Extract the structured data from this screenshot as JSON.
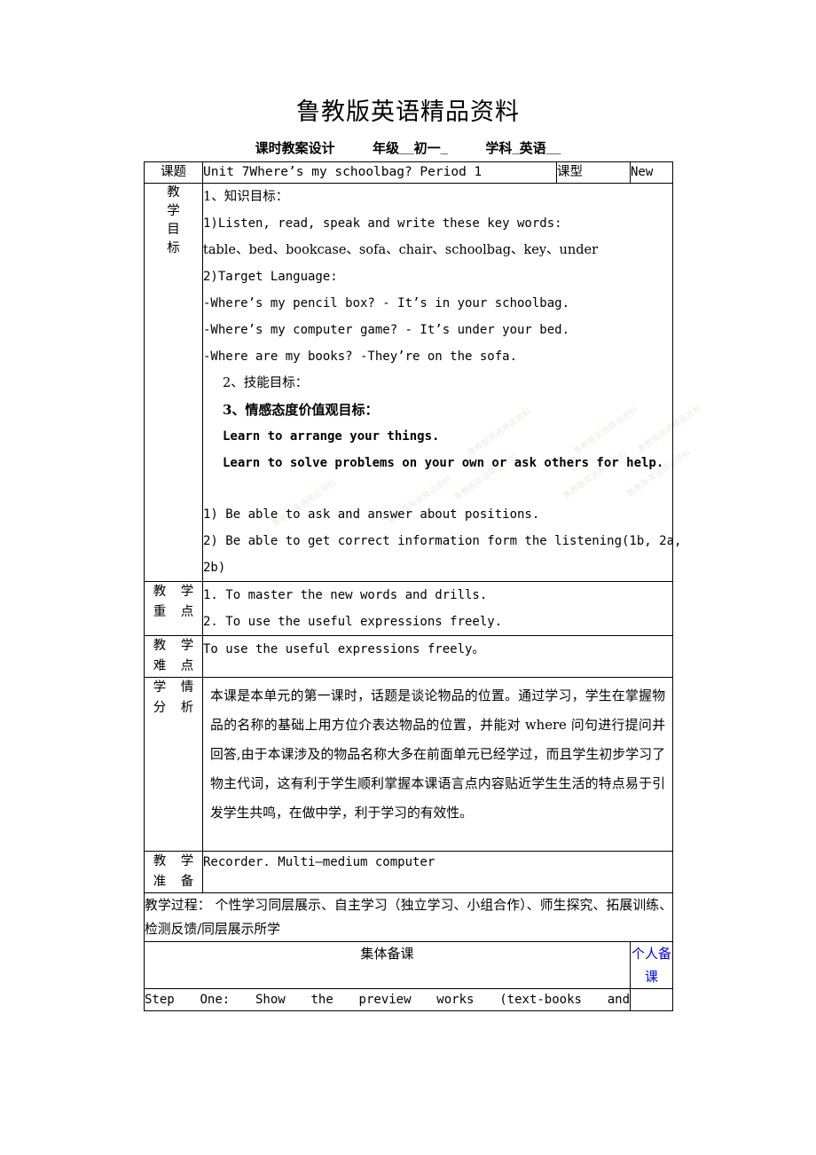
{
  "header": {
    "title": "鲁教版英语精品资料",
    "subtitle_main": "课时教案设计",
    "subtitle_grade": "年级__初一_",
    "subtitle_subject": "学科_英语__"
  },
  "watermark": {
    "text": "鲁教版英语精品资料",
    "color": "#d9c9b8"
  },
  "colors": {
    "text": "#000000",
    "accent_blue": "#0000ff",
    "border": "#000000"
  },
  "table": {
    "topic_row": {
      "label": "课题",
      "value": "Unit 7Where’s my schoolbag? Period 1",
      "type_label": "课型",
      "type_value": "New"
    },
    "objectives_row": {
      "label_chars": [
        "教",
        "学",
        "目",
        "标"
      ],
      "lines": [
        {
          "id": "knowledge_heading",
          "text": "1、知识目标：",
          "style": "cn"
        },
        {
          "id": "knowledge_1",
          "text": "1)Listen, read, speak and write these key words:",
          "style": "mono"
        },
        {
          "id": "key_words",
          "text": "table、bed、bookcase、sofa、chair、schoolbag、key、under",
          "style": "serif"
        },
        {
          "id": "knowledge_2",
          "text": "2)Target Language:",
          "style": "mono"
        },
        {
          "id": "target_1",
          "text": "-Where’s my pencil box? - It’s in your schoolbag.",
          "style": "mono"
        },
        {
          "id": "target_2",
          "text": "-Where’s my computer game? - It’s under your bed.",
          "style": "mono"
        },
        {
          "id": "target_3",
          "text": "-Where are my books?    -They’re on the sofa.",
          "style": "mono"
        },
        {
          "id": "skill_heading",
          "text": "2、技能目标：",
          "style": "cn"
        },
        {
          "id": "attitude_heading",
          "text": "3、情感态度价值观目标：",
          "style": "bold-cn-indent"
        },
        {
          "id": "attitude_1",
          "text": "Learn to arrange your things.",
          "style": "bold-indent"
        },
        {
          "id": "attitude_2",
          "text": "Learn to solve problems on your own or ask others for help.",
          "style": "bold-indent"
        },
        {
          "id": "spacer",
          "text": "",
          "style": "spacer"
        },
        {
          "id": "ability_1",
          "text": "1) Be able to ask and answer about positions.",
          "style": "mono"
        },
        {
          "id": "ability_2",
          "text": "2) Be able to get correct information form the listening(1b, 2a,",
          "style": "mono"
        },
        {
          "id": "ability_2_cont",
          "text": "2b)",
          "style": "mono"
        }
      ]
    },
    "key_points_row": {
      "label_line1": "教 学",
      "label_line2": "重 点",
      "lines": [
        "1. To master the new words and drills.",
        "2. To use the useful expressions freely."
      ]
    },
    "difficult_points_row": {
      "label_line1": "教 学",
      "label_line2": "难 点",
      "lines": [
        "To use the useful expressions freely。"
      ]
    },
    "analysis_row": {
      "label_line1": "学 情",
      "label_line2": "分 析",
      "paragraph": "本课是本单元的第一课时，话题是谈论物品的位置。通过学习，学生在掌握物品的名称的基础上用方位介表达物品的位置，并能对 where 问句进行提问并回答,由于本课涉及的物品名称大多在前面单元已经学过，而且学生初步学习了物主代词，这有利于学生顺利掌握本课语言点内容贴近学生生活的特点易于引发学生共鸣，在做中学，利于学习的有效性。"
    },
    "preparation_row": {
      "label_line1": "教 学",
      "label_line2": "准 备",
      "value": "Recorder. Multi—medium computer"
    },
    "process_row": {
      "text": "教学过程： 个性学习同层展示、自主学习（独立学习、小组合作）、师生探究、拓展训练、检测反馈/同层展示所学"
    },
    "prep_headings_row": {
      "collective": "集体备课",
      "individual": "个人备课"
    },
    "step_row": {
      "text": "Step One: Show the preview works (text-books and",
      "individual_note": ""
    }
  }
}
